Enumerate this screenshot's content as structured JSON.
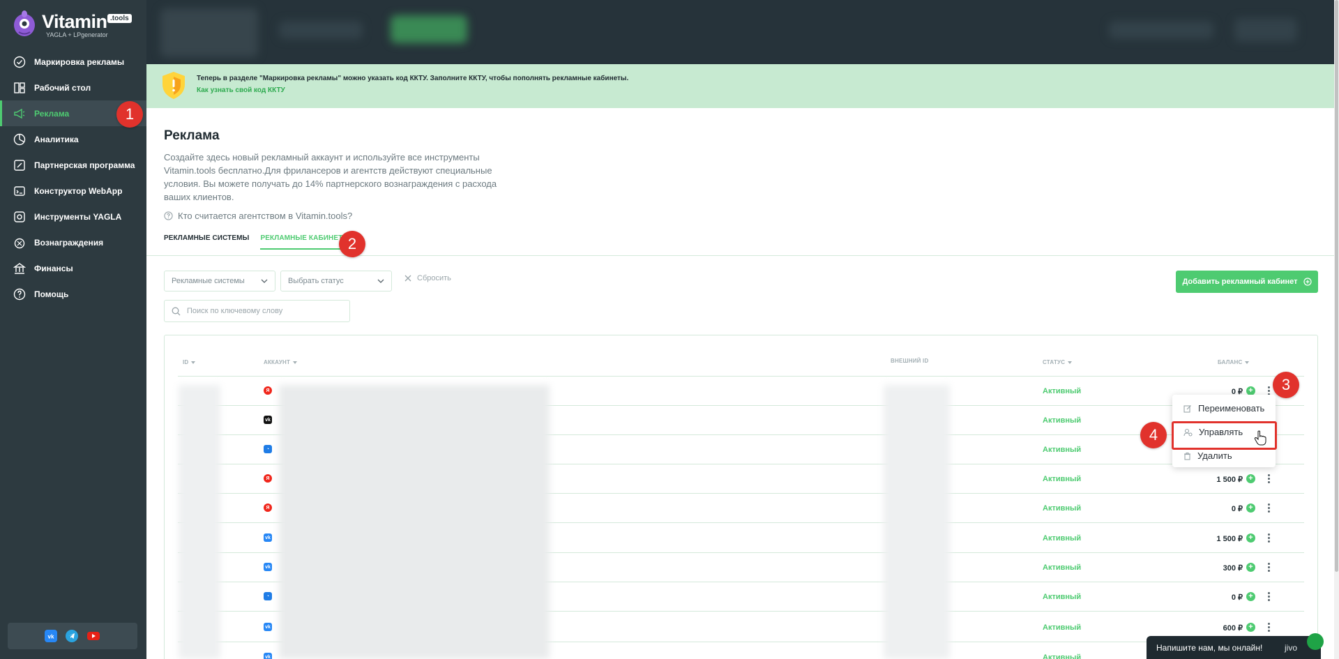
{
  "brand": {
    "name": "Vitamin",
    "badge": ".tools",
    "subtitle": "YAGLA + LPgenerator"
  },
  "sidebar": {
    "items": [
      {
        "label": "Маркировка рекламы",
        "icon": "check-circle-icon"
      },
      {
        "label": "Рабочий стол",
        "icon": "dashboard-icon"
      },
      {
        "label": "Реклама",
        "icon": "megaphone-icon",
        "active": true
      },
      {
        "label": "Аналитика",
        "icon": "analytics-icon"
      },
      {
        "label": "Партнерская программа",
        "icon": "link-icon"
      },
      {
        "label": "Конструктор WebApp",
        "icon": "webapp-icon"
      },
      {
        "label": "Инструменты YAGLA",
        "icon": "tools-icon"
      },
      {
        "label": "Вознаграждения",
        "icon": "reward-icon"
      },
      {
        "label": "Финансы",
        "icon": "finance-icon"
      },
      {
        "label": "Помощь",
        "icon": "help-icon"
      }
    ],
    "social": [
      "vk-icon",
      "telegram-icon",
      "youtube-icon"
    ]
  },
  "notice": {
    "text": "Теперь в разделе \"Маркировка рекламы\" можно указать код ККТУ. Заполните ККТУ, чтобы пополнять рекламные кабинеты.",
    "link": "Как узнать свой код ККТУ"
  },
  "page": {
    "title": "Реклама",
    "description": "Создайте здесь новый рекламный аккаунт и используйте все инструменты Vitamin.tools бесплатно.Для фрилансеров и агентств действуют специальные условия. Вы можете получать до 14% партнерского вознаграждения с расхода ваших клиентов.",
    "agency_question": "Кто считается агентством в Vitamin.tools?"
  },
  "tabs": [
    {
      "label": "РЕКЛАМНЫЕ СИСТЕМЫ",
      "active": false
    },
    {
      "label": "РЕКЛАМНЫЕ КАБИНЕТЫ",
      "active": true
    }
  ],
  "filters": {
    "systems_select": "Рекламные системы",
    "status_select": "Выбрать статус",
    "reset": "Сбросить",
    "search_placeholder": "Поиск по ключевому слову",
    "add_button": "Добавить рекламный кабинет"
  },
  "table": {
    "columns": {
      "id": "ID",
      "account": "АККАУНТ",
      "external_id": "ВНЕШНИЙ ID",
      "status": "СТАТУС",
      "balance": "БАЛАНС"
    },
    "rows": [
      {
        "system": "yandex",
        "status": "Активный",
        "balance": "0 ₽"
      },
      {
        "system": "vk-ads",
        "status": "Активный",
        "balance": ""
      },
      {
        "system": "mytarget",
        "status": "Активный",
        "balance": ""
      },
      {
        "system": "yandex",
        "status": "Активный",
        "balance": "1 500 ₽"
      },
      {
        "system": "yandex",
        "status": "Активный",
        "balance": "0 ₽"
      },
      {
        "system": "vk",
        "status": "Активный",
        "balance": "1 500 ₽"
      },
      {
        "system": "vk",
        "status": "Активный",
        "balance": "300 ₽"
      },
      {
        "system": "mytarget",
        "status": "Активный",
        "balance": "0 ₽"
      },
      {
        "system": "vk",
        "status": "Активный",
        "balance": "600 ₽"
      },
      {
        "system": "vk",
        "status": "Активный",
        "balance": ""
      }
    ]
  },
  "row_menu": {
    "rename": "Переименовать",
    "manage": "Управлять",
    "delete": "Удалить"
  },
  "markers": [
    "1",
    "2",
    "3",
    "4"
  ],
  "chat": {
    "text": "Напишите нам, мы онлайн!",
    "brand": "jivo"
  },
  "colors": {
    "accent": "#4ecb71",
    "sidebar": "#2d3a40",
    "marker": "#e1322c",
    "notice_bg": "#c7ead1"
  }
}
